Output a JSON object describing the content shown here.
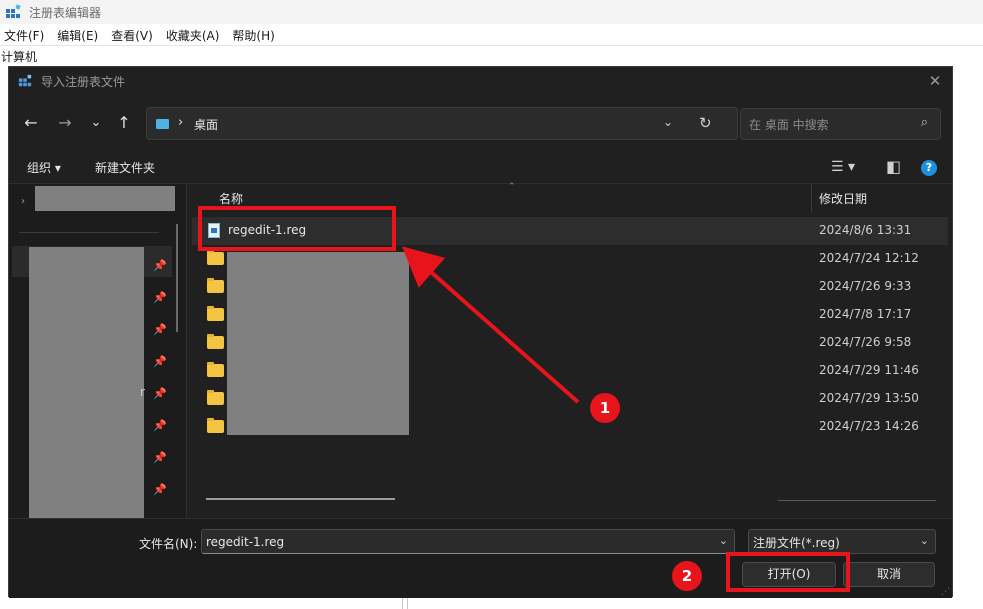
{
  "app": {
    "title": "注册表编辑器",
    "menu": [
      "文件(F)",
      "编辑(E)",
      "查看(V)",
      "收藏夹(A)",
      "帮助(H)"
    ],
    "address": "计算机"
  },
  "dialog": {
    "title": "导入注册表文件",
    "close_glyph": "✕",
    "nav": {
      "back_glyph": "←",
      "forward_glyph": "→",
      "recent_glyph": "⌄",
      "up_glyph": "↑"
    },
    "address_bar": {
      "separator": "›",
      "path": "桌面",
      "dropdown_glyph": "⌄",
      "refresh_glyph": "↻"
    },
    "search": {
      "placeholder": "在 桌面 中搜索",
      "icon_glyph": "⌕"
    },
    "toolbar": {
      "organize": "组织 ▾",
      "new_folder": "新建文件夹",
      "view_glyph": "☰ ▾",
      "pane_glyph": "◧",
      "help_glyph": "?"
    },
    "columns": {
      "name": "名称",
      "date": "修改日期",
      "sort_glyph": "⌃"
    },
    "files": [
      {
        "name": "regedit-1.reg",
        "date": "2024/8/6 13:31",
        "type": "reg",
        "selected": true
      },
      {
        "name": "",
        "date": "2024/7/24 12:12",
        "type": "folder",
        "selected": false
      },
      {
        "name": "",
        "date": "2024/7/26 9:33",
        "type": "folder",
        "selected": false
      },
      {
        "name": "",
        "date": "2024/7/8 17:17",
        "type": "folder",
        "selected": false
      },
      {
        "name": "",
        "date": "2024/7/26 9:58",
        "type": "folder",
        "selected": false
      },
      {
        "name": "",
        "date": "2024/7/29 11:46",
        "type": "folder",
        "selected": false
      },
      {
        "name": "",
        "date": "2024/7/29 13:50",
        "type": "folder",
        "selected": false
      },
      {
        "name": "",
        "date": "2024/7/23 14:26",
        "type": "folder",
        "selected": false
      }
    ],
    "nav_pane": {
      "expand_glyph": "›",
      "pin_glyph": "📌",
      "stray_char": "r"
    },
    "footer": {
      "filename_label": "文件名(N):",
      "filename_value": "regedit-1.reg",
      "filetype_value": "注册文件(*.reg)",
      "open_button": "打开(O)",
      "cancel_button": "取消",
      "dropdown_glyph": "⌄",
      "grip_glyph": "⋰"
    }
  },
  "annotations": {
    "step1": "1",
    "step2": "2",
    "color": "#e8141b"
  }
}
